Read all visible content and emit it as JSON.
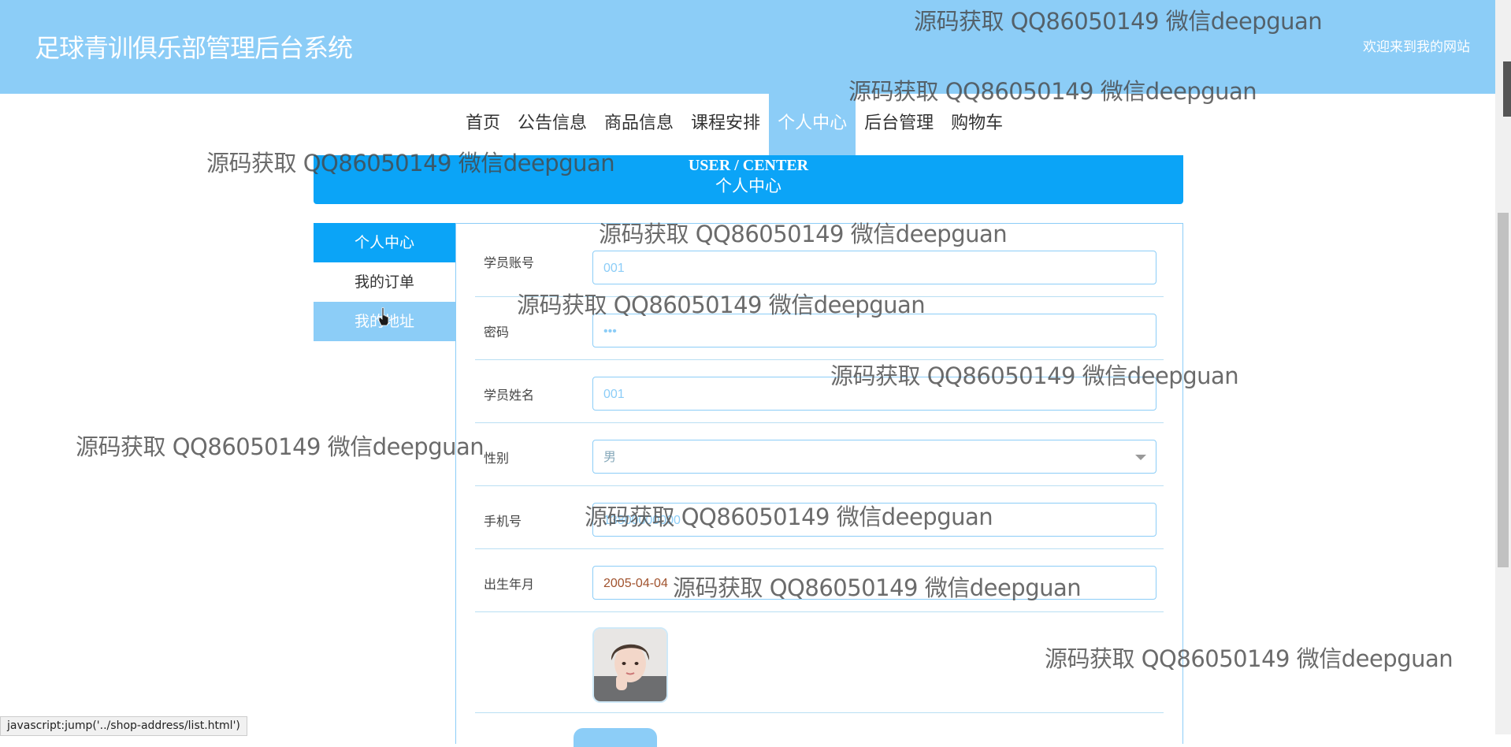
{
  "header": {
    "site_title": "足球青训俱乐部管理后台系统",
    "welcome": "欢迎来到我的网站"
  },
  "nav": {
    "items": [
      "首页",
      "公告信息",
      "商品信息",
      "课程安排",
      "个人中心",
      "后台管理",
      "购物车"
    ],
    "active": "个人中心"
  },
  "banner": {
    "subtitle_en": "USER / CENTER",
    "title_cn": "个人中心"
  },
  "sidebar": {
    "items": [
      "个人中心",
      "我的订单",
      "我的地址"
    ]
  },
  "form": {
    "account_label": "学员账号",
    "account_value": "001",
    "password_label": "密码",
    "password_value": "•••",
    "name_label": "学员姓名",
    "name_value": "001",
    "gender_label": "性别",
    "gender_value": "男",
    "phone_label": "手机号",
    "phone_value": "13800000000",
    "birth_label": "出生年月",
    "birth_value": "2005-04-04"
  },
  "watermark": "源码获取 QQ86050149 微信deepguan",
  "status_bar": "javascript:jump('../shop-address/list.html')",
  "colors": {
    "header_bg": "#8ccdf7",
    "accent": "#0ba4f7"
  }
}
